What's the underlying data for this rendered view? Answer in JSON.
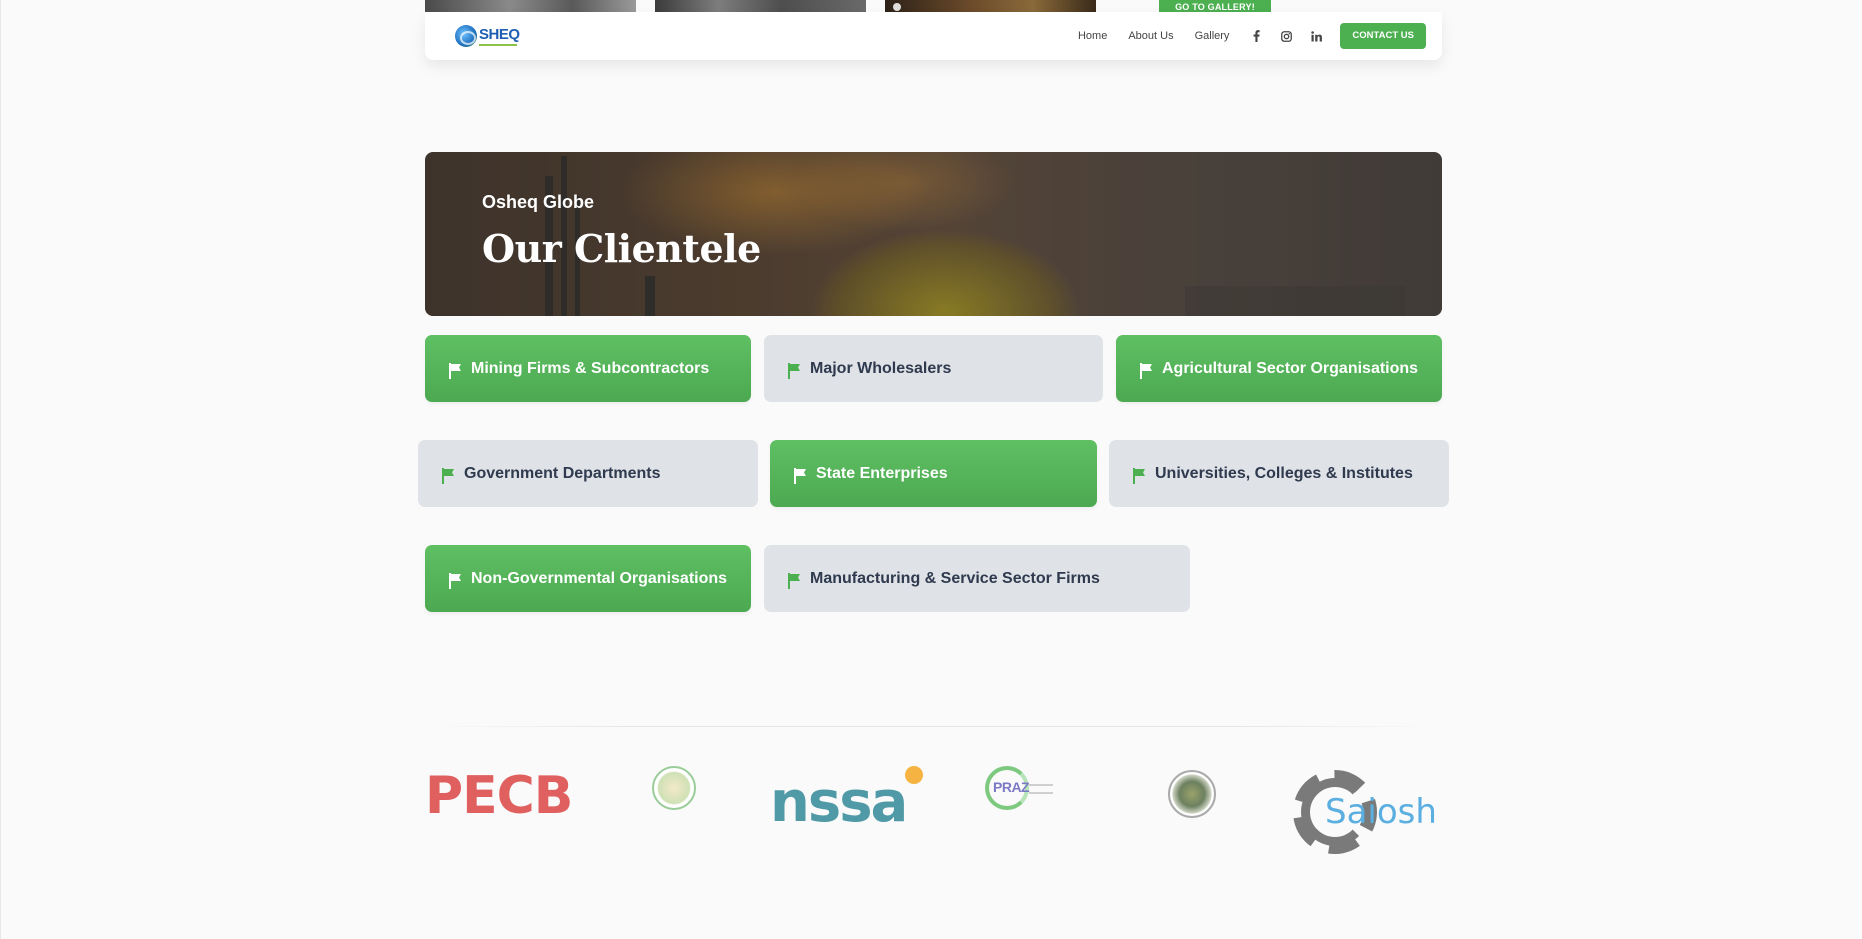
{
  "gallery": {
    "button_label": "GO TO GALLERY!"
  },
  "navbar": {
    "logo_text": "SHEQ",
    "links": [
      {
        "label": "Home"
      },
      {
        "label": "About Us"
      },
      {
        "label": "Gallery"
      }
    ],
    "social_icons": [
      "facebook-icon",
      "instagram-icon",
      "linkedin-icon"
    ],
    "contact_label": "CONTACT US"
  },
  "hero": {
    "subtitle": "Osheq Globe",
    "title": "Our Clientele"
  },
  "categories": [
    {
      "label": "Mining Firms & Subcontractors",
      "style": "green"
    },
    {
      "label": "Major Wholesalers",
      "style": "grey"
    },
    {
      "label": "Agricultural Sector Organisations",
      "style": "green"
    },
    {
      "label": "Government Departments",
      "style": "grey"
    },
    {
      "label": "State Enterprises",
      "style": "green"
    },
    {
      "label": "Universities, Colleges & Institutes",
      "style": "grey"
    },
    {
      "label": "Non-Governmental Organisations",
      "style": "green"
    },
    {
      "label": "Manufacturing & Service Sector Firms",
      "style": "grey"
    }
  ],
  "client_logos": {
    "pecb": "PECB",
    "nssa": "nssa",
    "praz": "PRAZ",
    "saiosh": "Saiosh"
  },
  "colors": {
    "accent_green": "#4caf50",
    "card_grey": "#dfe2e7",
    "card_text_dark": "#2f3a4e"
  }
}
